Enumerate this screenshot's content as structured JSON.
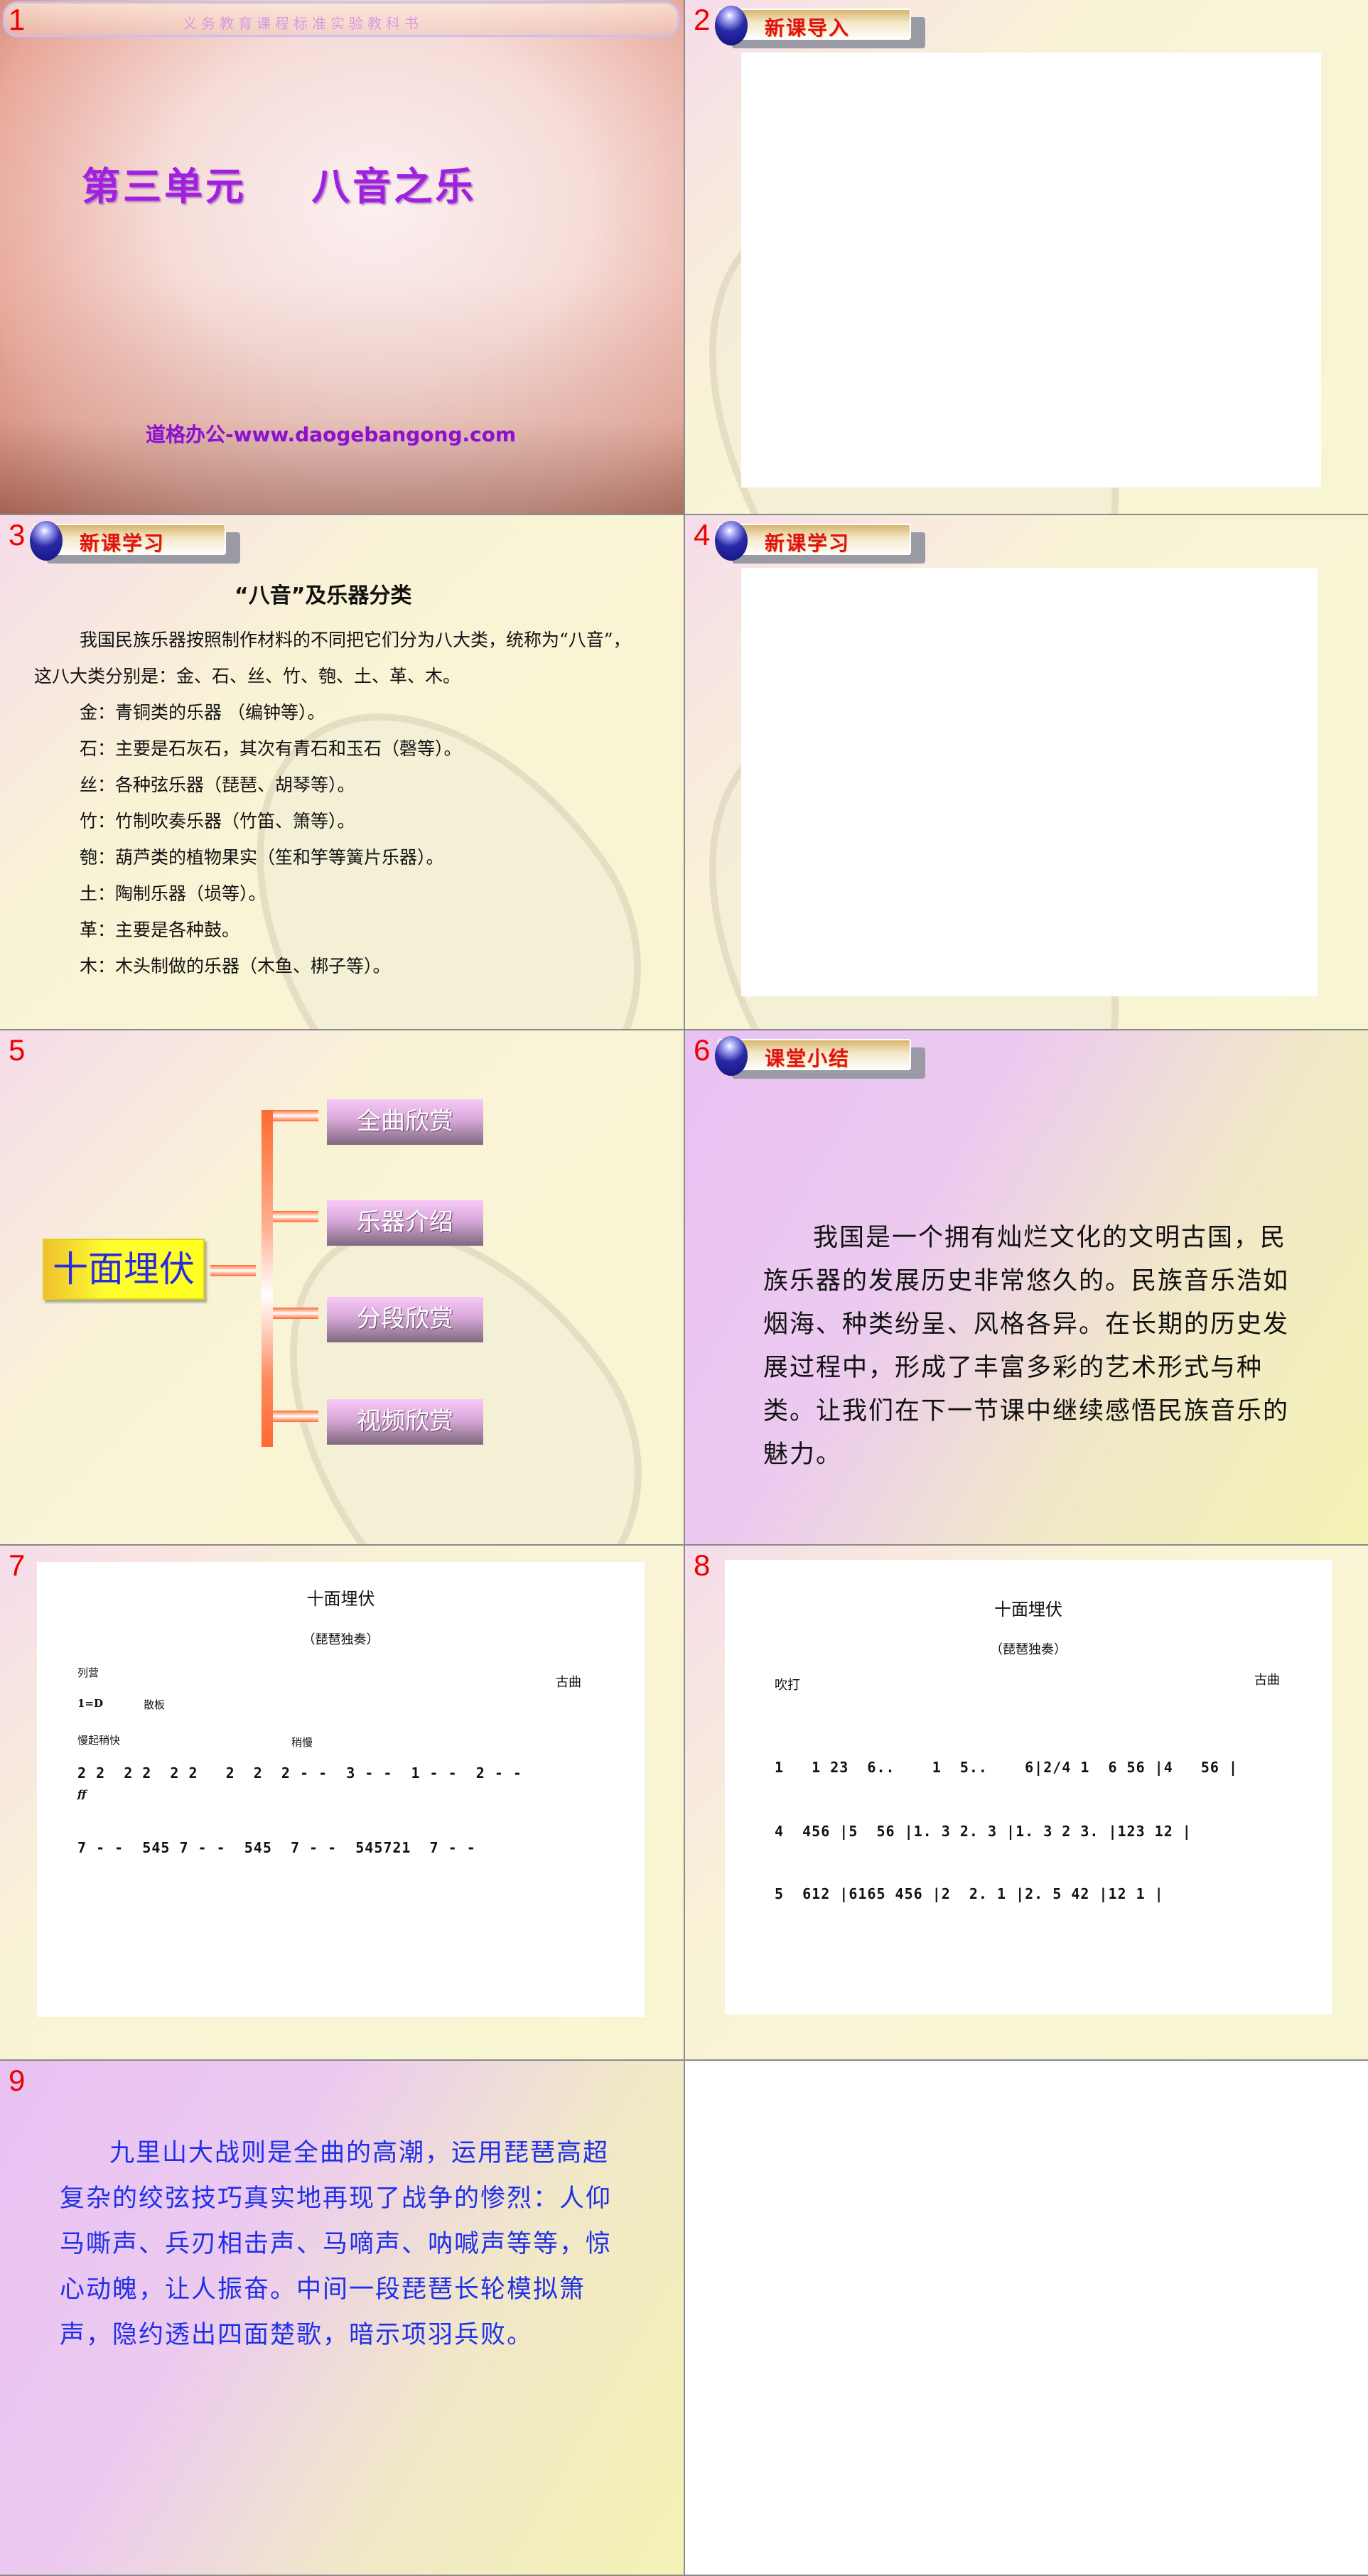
{
  "slides": [
    {
      "number": "1",
      "banner": "义务教育课程标准实验教科书",
      "title": "第三单元    八音之乐",
      "url": "道格办公-www.daogebangong.com"
    },
    {
      "number": "2",
      "badge": "新课导入"
    },
    {
      "number": "3",
      "badge": "新课学习",
      "heading": "“八音”及乐器分类",
      "intro": "我国民族乐器按照制作材料的不同把它们分为八大类，统称为“八音”，这八大类分别是：金、石、丝、竹、匏、土、革、木。",
      "items": [
        "金：青铜类的乐器 （编钟等）。",
        "石：主要是石灰石，其次有青石和玉石（磬等）。",
        "丝：各种弦乐器（琵琶、胡琴等）。",
        "竹：竹制吹奏乐器（竹笛、箫等）。",
        "匏：葫芦类的植物果实（笙和竽等簧片乐器）。",
        "土：陶制乐器（埙等）。",
        "革：主要是各种鼓。",
        "木：木头制做的乐器（木鱼、梆子等）。"
      ]
    },
    {
      "number": "4",
      "badge": "新课学习"
    },
    {
      "number": "5",
      "center": "十面埋伏",
      "buttons": [
        "全曲欣赏",
        "乐器介绍",
        "分段欣赏",
        "视频欣赏"
      ]
    },
    {
      "number": "6",
      "badge": "课堂小结",
      "text": "我国是一个拥有灿烂文化的文明古国，民族乐器的发展历史非常悠久的。民族音乐浩如烟海、种类纷呈、风格各异。在长期的历史发展过程中，形成了丰富多彩的艺术形式与种类。让我们在下一节课中继续感悟民族音乐的魅力。"
    },
    {
      "number": "7",
      "title": "十面埋伏",
      "subtitle": "（琵琶独奏）",
      "section": "列营",
      "composer": "古曲",
      "key": "1=D",
      "meter": "散板",
      "tempo1": "慢起稍快",
      "tempo2": "稍慢",
      "dynamic": "ff",
      "rows": [
        "2 2  2 2  2 2   2  2  2 - -  3 - -  1 - -  2 - -",
        "7 - -  545 7 - -  545  7 - -  545721  7 - -"
      ]
    },
    {
      "number": "8",
      "title": "十面埋伏",
      "subtitle": "（琵琶独奏）",
      "section": "吹打",
      "composer": "古曲",
      "rows": [
        "1   1 23  6..    1  5..    6|2/4 1  6 56 |4   56 |",
        "4  456 |5  56 |1. 3 2. 3 |1. 3 2 3. |123 12 |",
        "5  612 |6165 456 |2  2. 1 |2. 5 42 |12 1 |"
      ]
    },
    {
      "number": "9",
      "text": "九里山大战则是全曲的高潮，运用琵琶高超复杂的绞弦技巧真实地再现了战争的惨烈：人仰马嘶声、兵刃相击声、马嘀声、呐喊声等等，惊心动魄，让人振奋。中间一段琵琶长轮模拟箫声，隐约透出四面楚歌，暗示项羽兵败。"
    }
  ],
  "colors": {
    "slide_number": "#e00000",
    "badge_text": "#e0101a",
    "title_purple": "#a020e0",
    "center_text": "#2a2ae0",
    "slide9_text": "#2030e8"
  }
}
